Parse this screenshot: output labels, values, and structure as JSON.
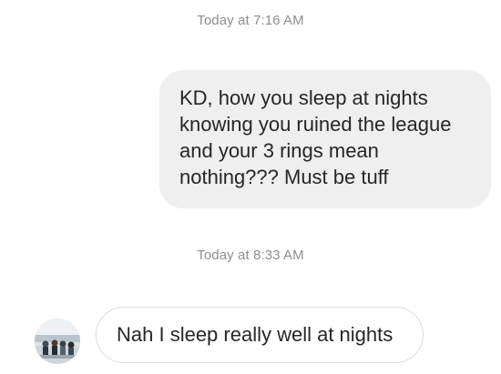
{
  "conversation": {
    "timestamps": [
      "Today at 7:16 AM",
      "Today at 8:33 AM"
    ],
    "sent_message": {
      "lines": [
        "KD, how you sleep at nights",
        "knowing you ruined the league",
        "and your 3 rings mean",
        "nothing??? Must be tuff"
      ]
    },
    "received_message": {
      "text": "Nah I sleep really well at nights"
    }
  },
  "colors": {
    "sent_bubble": "#efefef",
    "received_bubble_border": "#dbdbdb",
    "timestamp_text": "#8e8e8e",
    "message_text": "#262626"
  },
  "icons": {
    "avatar": "user-avatar-photo"
  }
}
